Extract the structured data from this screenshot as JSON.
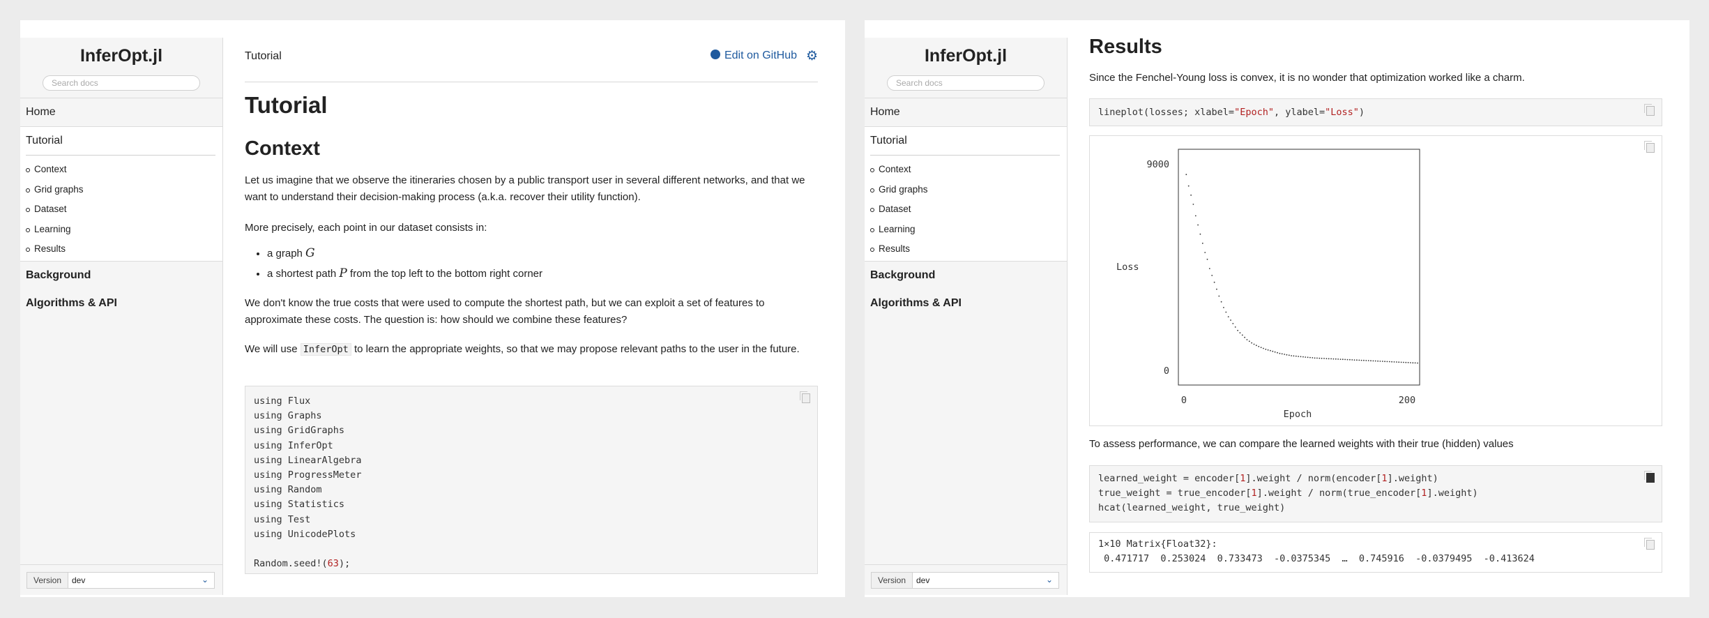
{
  "sidebar": {
    "title": "InferOpt.jl",
    "search_placeholder": "Search docs",
    "home_label": "Home",
    "tutorial_label": "Tutorial",
    "subitems": [
      "Context",
      "Grid graphs",
      "Dataset",
      "Learning",
      "Results"
    ],
    "background_label": "Background",
    "algorithms_label": "Algorithms & API",
    "version_label": "Version",
    "version_value": "dev"
  },
  "left_page": {
    "breadcrumb": "Tutorial",
    "edit_label": "Edit on GitHub",
    "title": "Tutorial",
    "section_title": "Context",
    "para1": "Let us imagine that we observe the itineraries chosen by a public transport user in several different networks, and that we want to understand their decision-making process (a.k.a. recover their utility function).",
    "para2": "More precisely, each point in our dataset consists in:",
    "bullet1_text": "a graph",
    "bullet1_math": "G",
    "bullet2_text_before": "a shortest path",
    "bullet2_math": "P",
    "bullet2_text_after": "from the top left to the bottom right corner",
    "para3": "We don't know the true costs that were used to compute the shortest path, but we can exploit a set of features to approximate these costs. The question is: how should we combine these features?",
    "para4_before": "We will use",
    "para4_code": "InferOpt",
    "para4_after": "to learn the appropriate weights, so that we may propose relevant paths to the user in the future.",
    "code_keyword": "using",
    "code_modules": [
      "Flux",
      "Graphs",
      "GridGraphs",
      "InferOpt",
      "LinearAlgebra",
      "ProgressMeter",
      "Random",
      "Statistics",
      "Test",
      "UnicodePlots"
    ],
    "code_seed_prefix": "Random.seed!(",
    "code_seed_value": "63",
    "code_seed_suffix": ");"
  },
  "right_page": {
    "results_title": "Results",
    "intro": "Since the Fenchel-Young loss is convex, it is no wonder that optimization worked like a charm.",
    "plot_code_prefix": "lineplot(losses; xlabel=",
    "plot_code_xlabel": "\"Epoch\"",
    "plot_code_mid": ", ylabel=",
    "plot_code_ylabel": "\"Loss\"",
    "plot_code_suffix": ")",
    "assess_text": "To assess performance, we can compare the learned weights with their true (hidden) values",
    "code2_line1_a": "learned_weight = encoder[",
    "code2_line1_n1": "1",
    "code2_line1_b": "].weight / norm(encoder[",
    "code2_line1_n2": "1",
    "code2_line1_c": "].weight)",
    "code2_line2_a": "true_weight = true_encoder[",
    "code2_line2_n1": "1",
    "code2_line2_b": "].weight / norm(true_encoder[",
    "code2_line2_n2": "1",
    "code2_line2_c": "].weight)",
    "code2_line3": "hcat(learned_weight, true_weight)",
    "output_line1": "1×10 Matrix{Float32}:",
    "output_line2": " 0.471717  0.253024  0.733473  -0.0375345  …  0.745916  -0.0379495  -0.413624"
  },
  "chart_data": {
    "type": "scatter",
    "title": "",
    "xlabel": "Epoch",
    "ylabel": "Loss",
    "xlim": [
      0,
      200
    ],
    "ylim": [
      0,
      9000
    ],
    "x_tick_labels": [
      "0",
      "200"
    ],
    "y_tick_labels": [
      "9000",
      "0"
    ],
    "x": [
      2,
      4,
      6,
      8,
      10,
      12,
      14,
      16,
      18,
      20,
      22,
      24,
      26,
      28,
      30,
      32,
      34,
      36,
      38,
      40,
      42,
      44,
      46,
      48,
      50,
      52,
      54,
      56,
      58,
      60,
      62,
      64,
      66,
      68,
      70,
      72,
      74,
      76,
      78,
      80,
      82,
      84,
      86,
      88,
      90,
      92,
      94,
      96,
      98,
      100,
      102,
      104,
      106,
      108,
      110,
      112,
      114,
      116,
      118,
      120,
      122,
      124,
      126,
      128,
      130,
      132,
      134,
      136,
      138,
      140,
      142,
      144,
      146,
      148,
      150,
      152,
      154,
      156,
      158,
      160,
      162,
      164,
      166,
      168,
      170,
      172,
      174,
      176,
      178,
      180,
      182,
      184,
      186,
      188,
      190,
      192,
      194,
      196,
      198,
      200
    ],
    "y": [
      8600,
      8100,
      7700,
      7300,
      6800,
      6400,
      6000,
      5600,
      5200,
      4900,
      4500,
      4200,
      3900,
      3600,
      3300,
      3050,
      2800,
      2600,
      2400,
      2250,
      2100,
      1950,
      1800,
      1700,
      1600,
      1500,
      1400,
      1330,
      1260,
      1200,
      1150,
      1100,
      1060,
      1020,
      980,
      950,
      920,
      890,
      860,
      830,
      800,
      780,
      760,
      740,
      720,
      700,
      690,
      680,
      670,
      660,
      650,
      640,
      630,
      620,
      610,
      600,
      595,
      590,
      585,
      580,
      575,
      570,
      565,
      560,
      555,
      550,
      545,
      540,
      535,
      530,
      525,
      520,
      515,
      510,
      505,
      500,
      495,
      490,
      485,
      480,
      475,
      470,
      465,
      460,
      455,
      450,
      445,
      440,
      435,
      430,
      425,
      420,
      415,
      410,
      405,
      400,
      395,
      390,
      385,
      380
    ]
  },
  "colors": {
    "link": "#1f5a9e",
    "string": "#b22222",
    "sidebar_bg": "#f5f5f5"
  }
}
